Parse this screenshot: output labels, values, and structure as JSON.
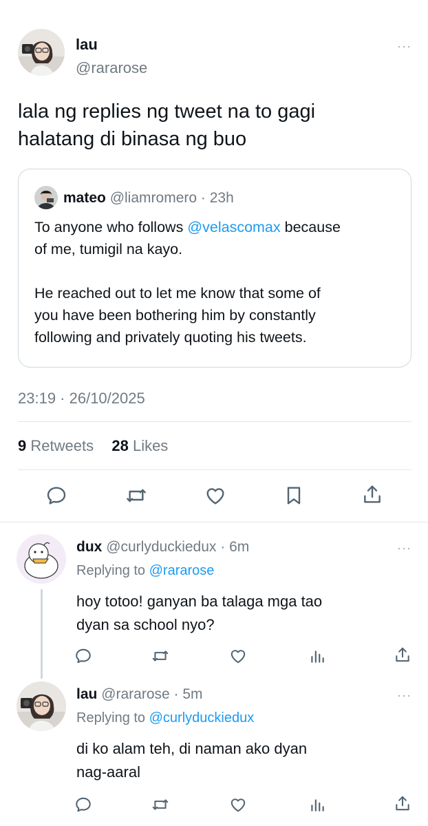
{
  "main_tweet": {
    "name": "lau",
    "handle": "@rararose",
    "text_line1": "lala ng replies ng tweet na to gagi",
    "text_line2": "halatang di binasa ng buo",
    "timestamp": "23:19 · 26/10/2025",
    "retweets_count": "9",
    "retweets_label": "Retweets",
    "likes_count": "28",
    "likes_label": "Likes",
    "more": "···"
  },
  "quote": {
    "name": "mateo",
    "handle": "@liamromero",
    "time": "· 23h",
    "line1_pre": "To anyone who follows ",
    "mention": "@velascomax",
    "line1_post": " because",
    "line2": "of me, tumigil na kayo.",
    "line3": "He reached out to let me know that some of",
    "line4": "you have been bothering him by constantly",
    "line5": "following and privately quoting his tweets."
  },
  "replies": [
    {
      "name": "dux",
      "handle": "@curlyduckiedux",
      "time": "· 6m",
      "replying_label": "Replying to ",
      "replying_to": "@rararose",
      "text_line1": "hoy totoo! ganyan ba talaga mga tao",
      "text_line2": "dyan sa school nyo?"
    },
    {
      "name": "lau",
      "handle": "@rararose",
      "time": "· 5m",
      "replying_label": "Replying to ",
      "replying_to": "@curlyduckiedux",
      "text_line1": "di ko alam teh, di naman ako dyan",
      "text_line2": "nag-aaral"
    }
  ],
  "colors": {
    "link": "#1d9bf0",
    "muted": "#707a82",
    "icon": "#536471",
    "divider": "#e3e6e8"
  },
  "icons": [
    "reply-icon",
    "retweet-icon",
    "like-icon",
    "bookmark-icon",
    "share-icon",
    "analytics-icon"
  ]
}
